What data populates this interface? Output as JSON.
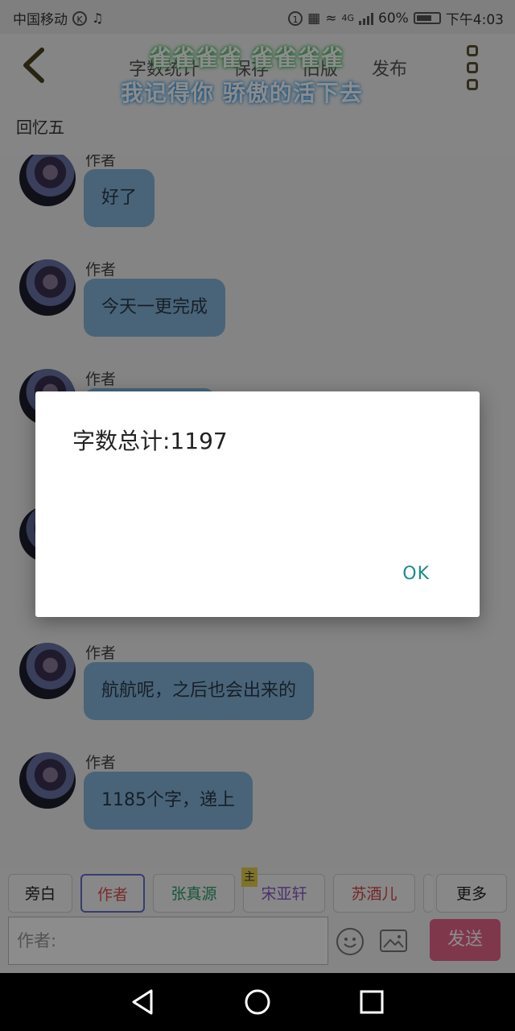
{
  "status_bar": {
    "carrier": "中国移动",
    "battery": "60%",
    "network": "4G",
    "time": "下午4:03"
  },
  "header": {
    "back_icon": "chevron-left-icon",
    "nav": [
      "字数统计",
      "保存",
      "旧版",
      "发布"
    ],
    "more_icon": "more-vertical-icon",
    "chapter_title": "回忆五",
    "overlay_line1": "雀雀雀雀 雀雀雀雀",
    "overlay_line2": "我记得你 骄傲的活下去"
  },
  "messages": [
    {
      "author": "作者",
      "text": "好了"
    },
    {
      "author": "作者",
      "text": "今天一更完成"
    },
    {
      "author": "作者",
      "text": ""
    },
    {
      "author": "作者",
      "text": ""
    },
    {
      "author": "作者",
      "text": "航航呢，之后也会出来的"
    },
    {
      "author": "作者",
      "text": "1185个字，递上"
    }
  ],
  "roles": [
    {
      "label": "旁白",
      "color": "#555555",
      "active": false
    },
    {
      "label": "作者",
      "color": "#d9534f",
      "active": true
    },
    {
      "label": "张真源",
      "color": "#2e9b6b",
      "active": false
    },
    {
      "label": "宋亚轩",
      "color": "#8a5cc8",
      "active": false,
      "badge": "主"
    },
    {
      "label": "苏酒儿",
      "color": "#d04848",
      "active": false
    },
    {
      "label": "更多",
      "color": "#555555",
      "active": false
    }
  ],
  "input": {
    "placeholder": "作者:"
  },
  "send_label": "发送",
  "dialog": {
    "message": "字数总计:1197",
    "ok_label": "OK"
  },
  "colors": {
    "bubble": "#86b6dc",
    "send_button": "#e8648a",
    "ok_text": "#1c8b8a"
  }
}
